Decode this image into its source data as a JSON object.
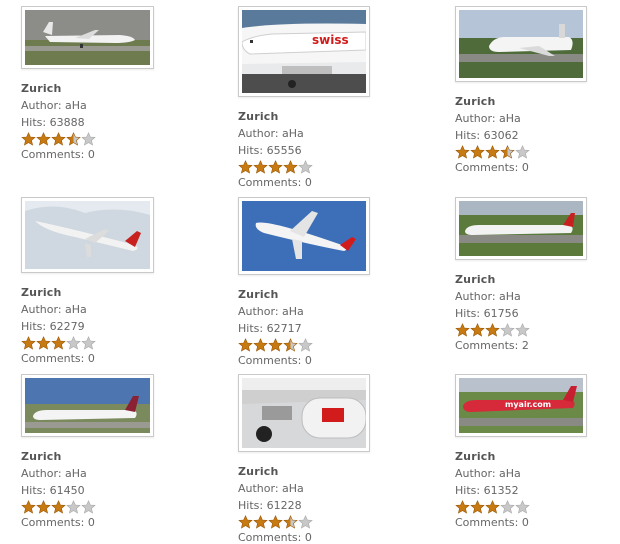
{
  "gallery": [
    {
      "title": "Zurich",
      "author": "Author: aHa",
      "hits": "Hits: 63888",
      "rating": 3.5,
      "comments": "Comments: 0"
    },
    {
      "title": "Zurich",
      "author": "Author: aHa",
      "hits": "Hits: 65556",
      "rating": 4,
      "comments": "Comments: 0"
    },
    {
      "title": "Zurich",
      "author": "Author: aHa",
      "hits": "Hits: 63062",
      "rating": 3.5,
      "comments": "Comments: 0"
    },
    {
      "title": "Zurich",
      "author": "Author: aHa",
      "hits": "Hits: 62279",
      "rating": 3,
      "comments": "Comments: 0"
    },
    {
      "title": "Zurich",
      "author": "Author: aHa",
      "hits": "Hits: 62717",
      "rating": 3.5,
      "comments": "Comments: 0"
    },
    {
      "title": "Zurich",
      "author": "Author: aHa",
      "hits": "Hits: 61756",
      "rating": 3,
      "comments": "Comments: 2"
    },
    {
      "title": "Zurich",
      "author": "Author: aHa",
      "hits": "Hits: 61450",
      "rating": 3,
      "comments": "Comments: 0"
    },
    {
      "title": "Zurich",
      "author": "Author: aHa",
      "hits": "Hits: 61228",
      "rating": 3.5,
      "comments": "Comments: 0"
    },
    {
      "title": "Zurich",
      "author": "Author: aHa",
      "hits": "Hits: 61352",
      "rating": 3,
      "comments": "Comments: 0"
    }
  ],
  "thumb_logos": {
    "swiss": "swiss",
    "myair": "myair.com"
  },
  "colors": {
    "star_filled": "#c77a12",
    "star_empty": "#c8c8c8",
    "text": "#666666"
  }
}
